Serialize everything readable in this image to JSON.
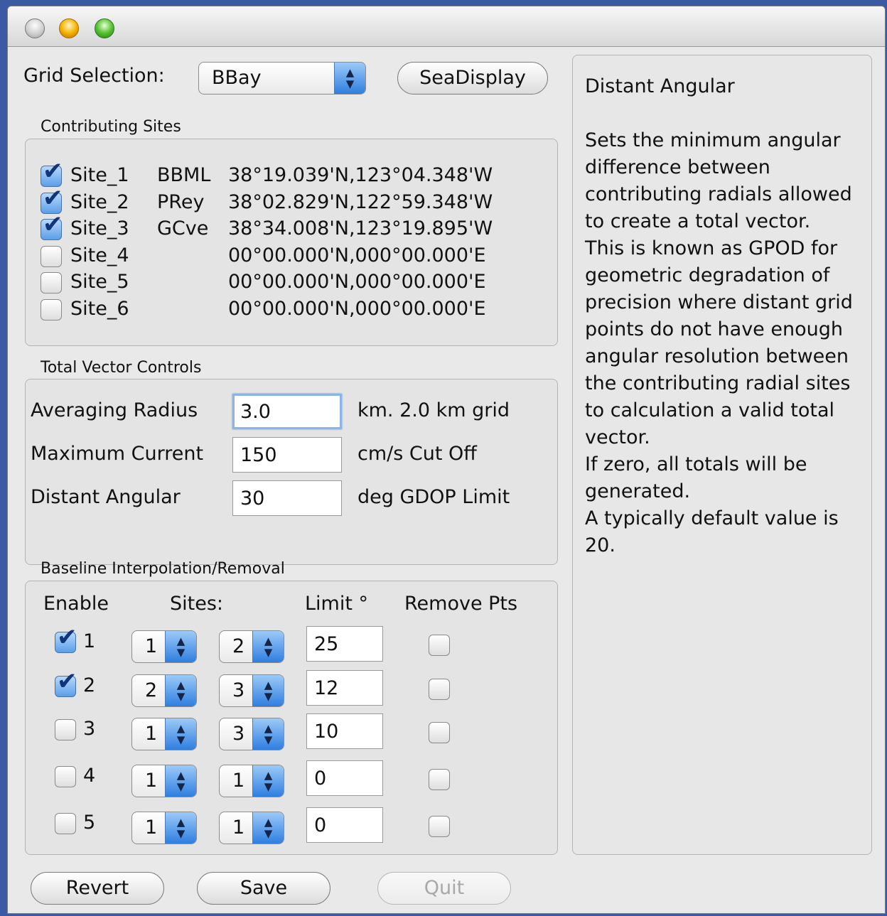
{
  "window": {
    "title": ""
  },
  "grid": {
    "label": "Grid Selection:",
    "value": "BBay",
    "sea_display_label": "SeaDisplay"
  },
  "contributing": {
    "title": "Contributing Sites",
    "sites": [
      {
        "checked": true,
        "name": "Site_1",
        "code": "BBML",
        "coords": "38°19.039'N,123°04.348'W"
      },
      {
        "checked": true,
        "name": "Site_2",
        "code": "PRey",
        "coords": "38°02.829'N,122°59.348'W"
      },
      {
        "checked": true,
        "name": "Site_3",
        "code": "GCve",
        "coords": "38°34.008'N,123°19.895'W"
      },
      {
        "checked": false,
        "name": "Site_4",
        "code": "",
        "coords": "00°00.000'N,000°00.000'E"
      },
      {
        "checked": false,
        "name": "Site_5",
        "code": "",
        "coords": "00°00.000'N,000°00.000'E"
      },
      {
        "checked": false,
        "name": "Site_6",
        "code": "",
        "coords": "00°00.000'N,000°00.000'E"
      }
    ]
  },
  "total_vector": {
    "title": "Total Vector Controls",
    "rows": [
      {
        "label": "Averaging Radius",
        "value": "3.0",
        "unit": "km. 2.0 km grid"
      },
      {
        "label": "Maximum Current",
        "value": "150",
        "unit": "cm/s Cut Off"
      },
      {
        "label": "Distant Angular",
        "value": "30",
        "unit": "deg GDOP Limit"
      }
    ]
  },
  "baseline": {
    "title": "Baseline Interpolation/Removal",
    "headers": {
      "enable": "Enable",
      "sites": "Sites:",
      "limit": "Limit °",
      "remove": "Remove Pts"
    },
    "rows": [
      {
        "enabled": true,
        "num": "1",
        "site_a": "1",
        "site_b": "2",
        "limit": "25",
        "remove": false
      },
      {
        "enabled": true,
        "num": "2",
        "site_a": "2",
        "site_b": "3",
        "limit": "12",
        "remove": false
      },
      {
        "enabled": false,
        "num": "3",
        "site_a": "1",
        "site_b": "3",
        "limit": "10",
        "remove": false
      },
      {
        "enabled": false,
        "num": "4",
        "site_a": "1",
        "site_b": "1",
        "limit": "0",
        "remove": false
      },
      {
        "enabled": false,
        "num": "5",
        "site_a": "1",
        "site_b": "1",
        "limit": "0",
        "remove": false
      }
    ]
  },
  "help": {
    "title": "Distant Angular",
    "paragraphs": [
      "Sets the minimum angular difference between contributing radials allowed to create a total vector.",
      "This is known as GPOD for geometric degradation of precision where distant grid points do not have enough angular resolution between the contributing radial sites to calculation a valid total vector.",
      "If zero, all totals will be generated.",
      "A typically default value is 20."
    ]
  },
  "buttons": {
    "revert": "Revert",
    "save": "Save",
    "quit": "Quit"
  }
}
